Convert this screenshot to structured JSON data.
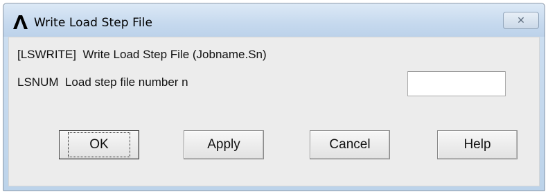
{
  "window": {
    "title": "Write Load Step File",
    "close_glyph": "✕",
    "app_icon": "ansys-logo-icon",
    "colors": {
      "titlebar": "#c6d9ee",
      "client": "#ececec",
      "logo": "#000000"
    }
  },
  "dialog": {
    "command_text": "[LSWRITE]  Write Load Step File (Jobname.Sn)",
    "param_text": "LSNUM  Load step file number n",
    "lsnum_value": ""
  },
  "buttons": {
    "ok": "OK",
    "apply": "Apply",
    "cancel": "Cancel",
    "help": "Help"
  }
}
